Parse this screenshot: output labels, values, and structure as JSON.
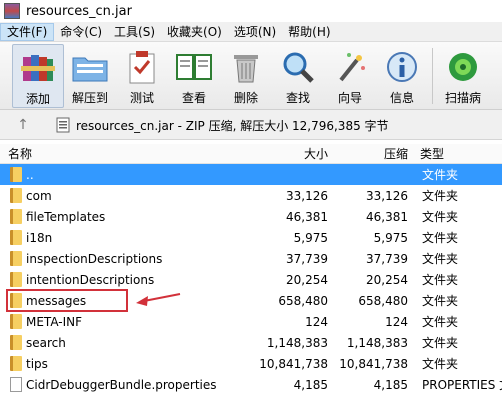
{
  "window": {
    "title": "resources_cn.jar"
  },
  "menu": [
    {
      "label": "文件(F)"
    },
    {
      "label": "命令(C)"
    },
    {
      "label": "工具(S)"
    },
    {
      "label": "收藏夹(O)"
    },
    {
      "label": "选项(N)"
    },
    {
      "label": "帮助(H)"
    }
  ],
  "toolbar": {
    "add": "添加",
    "extract": "解压到",
    "test": "测试",
    "view": "查看",
    "delete": "删除",
    "find": "查找",
    "wizard": "向导",
    "info": "信息",
    "scan": "扫描病"
  },
  "address": {
    "text": "resources_cn.jar - ZIP 压缩, 解压大小 12,796,385 字节"
  },
  "columns": {
    "name": "名称",
    "size": "大小",
    "packed": "压缩",
    "type": "类型"
  },
  "rows": [
    {
      "name": "..",
      "size": "",
      "packed": "",
      "type": "文件夹"
    },
    {
      "name": "com",
      "size": "33,126",
      "packed": "33,126",
      "type": "文件夹"
    },
    {
      "name": "fileTemplates",
      "size": "46,381",
      "packed": "46,381",
      "type": "文件夹"
    },
    {
      "name": "i18n",
      "size": "5,975",
      "packed": "5,975",
      "type": "文件夹"
    },
    {
      "name": "inspectionDescriptions",
      "size": "37,739",
      "packed": "37,739",
      "type": "文件夹"
    },
    {
      "name": "intentionDescriptions",
      "size": "20,254",
      "packed": "20,254",
      "type": "文件夹"
    },
    {
      "name": "messages",
      "size": "658,480",
      "packed": "658,480",
      "type": "文件夹"
    },
    {
      "name": "META-INF",
      "size": "124",
      "packed": "124",
      "type": "文件夹"
    },
    {
      "name": "search",
      "size": "1,148,383",
      "packed": "1,148,383",
      "type": "文件夹"
    },
    {
      "name": "tips",
      "size": "10,841,738",
      "packed": "10,841,738",
      "type": "文件夹"
    },
    {
      "name": "CidrDebuggerBundle.properties",
      "size": "4,185",
      "packed": "4,185",
      "type": "PROPERTIES 文"
    }
  ],
  "colors": {
    "selection": "#3399ff",
    "annotation": "#d2313a",
    "folder": "#f6cf62"
  }
}
